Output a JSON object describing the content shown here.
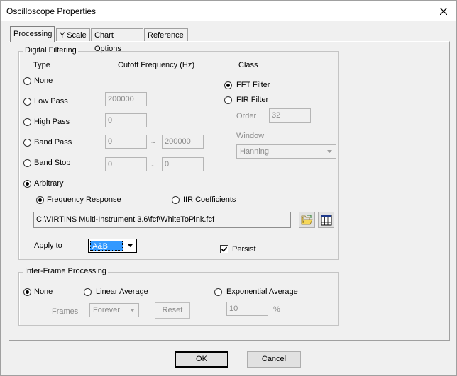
{
  "window": {
    "title": "Oscilloscope Properties"
  },
  "tabs": [
    {
      "label": "Processing",
      "active": true
    },
    {
      "label": "Y Scale"
    },
    {
      "label": "Chart Options"
    },
    {
      "label": "Reference"
    }
  ],
  "digital_filtering": {
    "title": "Digital Filtering",
    "headers": {
      "type": "Type",
      "cutoff": "Cutoff Frequency (Hz)",
      "class": "Class"
    },
    "types": {
      "none": "None",
      "low_pass": "Low Pass",
      "high_pass": "High Pass",
      "band_pass": "Band Pass",
      "band_stop": "Band Stop",
      "arbitrary": "Arbitrary"
    },
    "selected_type": "Arbitrary",
    "low_pass_value": "200000",
    "high_pass_value": "0",
    "band_pass_low": "0",
    "band_pass_high": "200000",
    "band_stop_low": "0",
    "band_stop_high": "0",
    "range_sep": "~",
    "class_options": {
      "fft": "FFT Filter",
      "fir": "FIR Filter"
    },
    "selected_class": "FFT Filter",
    "order_label": "Order",
    "order_value": "32",
    "window_label": "Window",
    "window_value": "Hanning",
    "arbitrary_modes": {
      "freq": "Frequency Response",
      "iir": "IIR Coefficients"
    },
    "selected_mode": "Frequency Response",
    "file_path": "C:\\VIRTINS Multi-Instrument 3.6\\fcf\\WhiteToPink.fcf",
    "apply_to_label": "Apply to",
    "apply_to_value": "A&B",
    "persist_label": "Persist",
    "persist_checked": true
  },
  "inter_frame": {
    "title": "Inter-Frame Processing",
    "options": {
      "none": "None",
      "linear": "Linear Average",
      "exp": "Exponential Average"
    },
    "selected": "None",
    "frames_label": "Frames",
    "frames_value": "Forever",
    "reset_label": "Reset",
    "exp_value": "10",
    "exp_unit": "%"
  },
  "footer": {
    "ok": "OK",
    "cancel": "Cancel"
  }
}
